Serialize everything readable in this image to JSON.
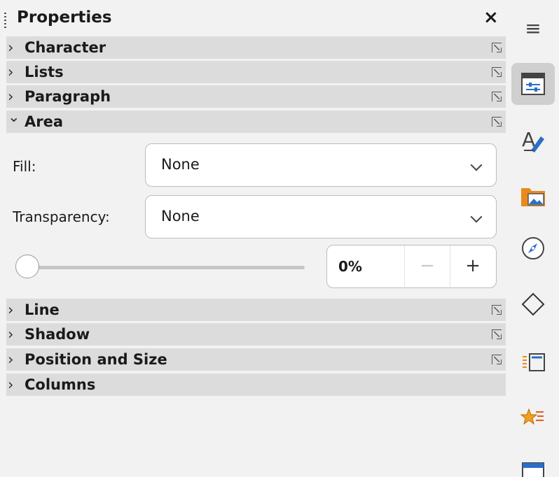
{
  "panel": {
    "title": "Properties",
    "close_label": "×"
  },
  "sections": {
    "character": {
      "label": "Character",
      "chevron": "›"
    },
    "lists": {
      "label": "Lists",
      "chevron": "›"
    },
    "paragraph": {
      "label": "Paragraph",
      "chevron": "›"
    },
    "area": {
      "label": "Area",
      "chevron": "⌄"
    },
    "line": {
      "label": "Line",
      "chevron": "›"
    },
    "shadow": {
      "label": "Shadow",
      "chevron": "›"
    },
    "position_size": {
      "label": "Position and Size",
      "chevron": "›"
    },
    "columns": {
      "label": "Columns",
      "chevron": "›"
    }
  },
  "area": {
    "fill_label": "Fill:",
    "fill_value": "None",
    "transparency_label": "Transparency:",
    "transparency_value": "None",
    "transparency_percent": "0%",
    "transparency_slider_value": 0,
    "minus": "−",
    "plus": "+"
  },
  "deck": {
    "menu_glyph": "≡",
    "items": [
      "properties",
      "styles",
      "gallery",
      "navigator",
      "shapes",
      "page",
      "animation",
      "master-slides"
    ],
    "active": "properties"
  },
  "colors": {
    "panel_bg": "#f2f2f2",
    "section_bg": "#dcdcdc",
    "active_deck": "#cfcfcf",
    "accent_blue": "#2a6fc9",
    "accent_orange": "#e98a1c"
  }
}
